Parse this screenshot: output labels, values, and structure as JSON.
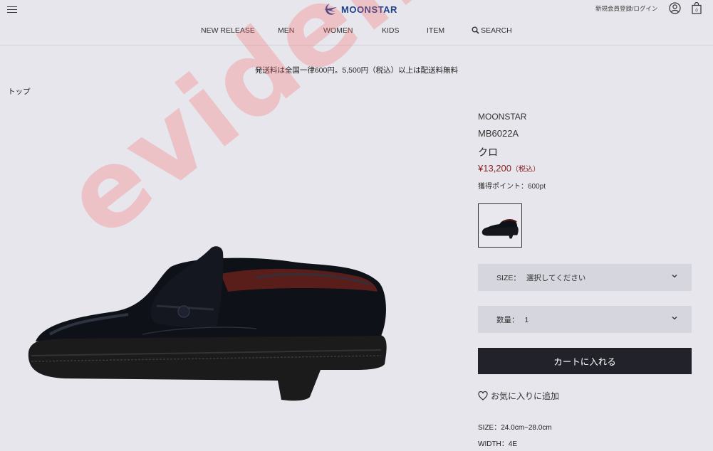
{
  "header": {
    "logo_text": "MOONSTAR",
    "login_label": "新規会員登録/ログイン",
    "brand_color": "#1d3f8c"
  },
  "nav": {
    "items": [
      "NEW RELEASE",
      "MEN",
      "WOMEN",
      "KIDS",
      "ITEM"
    ],
    "search_label": "SEARCH"
  },
  "banner": {
    "shipping": "発送料は全国一律600円。5,500円（税込）以上は配送料無料"
  },
  "breadcrumb": {
    "top": "トップ"
  },
  "watermark": "evidence",
  "product": {
    "brand": "MOONSTAR",
    "model": "MB6022A",
    "color_name": "クロ",
    "price": "¥13,200",
    "tax_note": "（税込）",
    "points": "獲得ポイント：600pt",
    "price_color": "#8a1c1c"
  },
  "size_select": {
    "label": "SIZE：",
    "value": "選択してください"
  },
  "qty_select": {
    "label": "数量：",
    "value": "1"
  },
  "cart_button": "カートに入れる",
  "favorite": "お気に入りに追加",
  "specs": {
    "size": "SIZE：24.0cm~28.0cm",
    "width": "WIDTH：4E"
  }
}
